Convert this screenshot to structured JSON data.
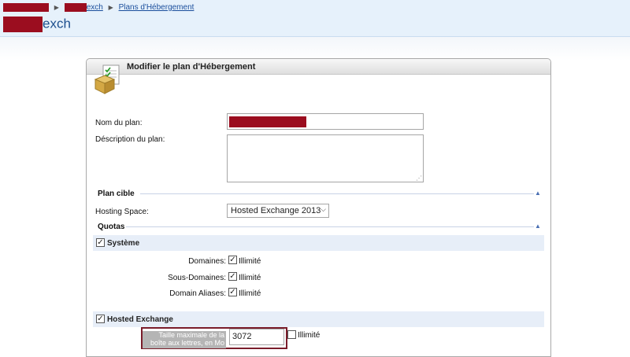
{
  "breadcrumb": {
    "item2_suffix": "exch",
    "item3": "Plans d'Hébergement"
  },
  "header": {
    "title_suffix": "exch"
  },
  "panel": {
    "title": "Modifier le plan d'Hébergement",
    "icon": "hosting-plan-icon"
  },
  "form": {
    "name_label": "Nom du plan:",
    "description_label": "Déscription du plan:",
    "description_value": ""
  },
  "target": {
    "title": "Plan cible",
    "hosting_space_label": "Hosting Space:",
    "hosting_space_value": "Hosted Exchange 2013"
  },
  "quotas": {
    "title": "Quotas",
    "systeme": {
      "label": "Système",
      "rows": [
        {
          "label": "Domaines:",
          "unlimited_label": "Illimité"
        },
        {
          "label": "Sous-Domaines:",
          "unlimited_label": "Illimité"
        },
        {
          "label": "Domain Aliases:",
          "unlimited_label": "Illimité"
        }
      ]
    },
    "exchange": {
      "label": "Hosted Exchange",
      "mailbox_label_line1": "Taille maximale de la",
      "mailbox_label_line2": "boîte aux lettres, en Mo",
      "mailbox_value": "3072",
      "unlimited_label": "Illimité"
    }
  },
  "colors": {
    "header_bg": "#e6f1fb",
    "link": "#1a4e9c",
    "redaction": "#9b0d1f",
    "group_bar": "#e7eef8",
    "highlight_box": "#7a1c2a"
  }
}
